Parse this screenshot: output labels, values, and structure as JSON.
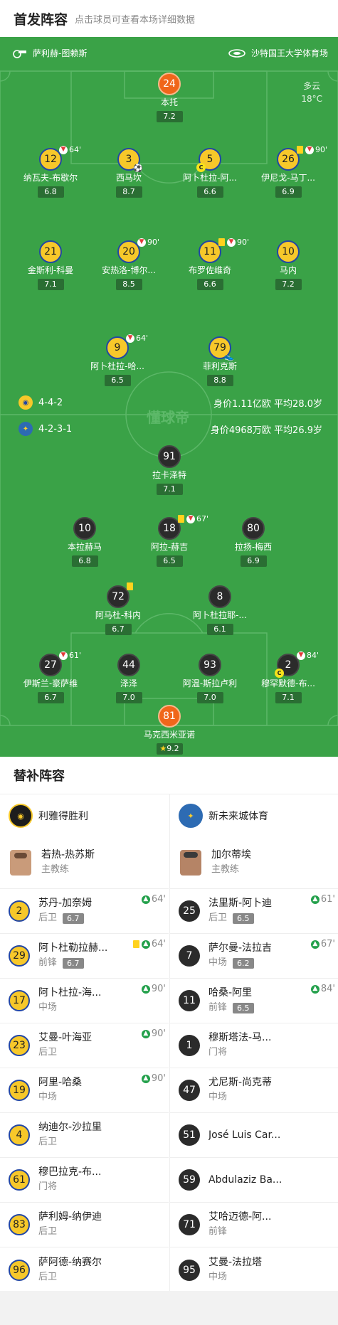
{
  "header": {
    "title": "首发阵容",
    "subtitle": "点击球员可查看本场详细数据"
  },
  "pitch": {
    "referee": "萨利赫-图赖斯",
    "venue": "沙特国王大学体育场",
    "weather": {
      "condition": "多云",
      "temp": "18°C"
    },
    "watermark": "懂球帝",
    "home_formation": "4-4-2",
    "home_value": "身价1.11亿欧  平均28.0岁",
    "away_formation": "4-2-3-1",
    "away_value": "身价4968万欧  平均26.9岁"
  },
  "home_players": [
    {
      "num": "24",
      "name": "本托",
      "rating": "7.2"
    },
    {
      "num": "12",
      "name": "纳瓦夫-布歇尔",
      "rating": "6.8",
      "sub": "64'"
    },
    {
      "num": "3",
      "name": "西马坎",
      "rating": "8.7"
    },
    {
      "num": "5",
      "name": "阿卜杜拉-阿...",
      "rating": "6.6",
      "cap": "C"
    },
    {
      "num": "26",
      "name": "伊尼戈-马丁...",
      "rating": "6.9",
      "sub": "90'"
    },
    {
      "num": "21",
      "name": "金斯利-科曼",
      "rating": "7.1"
    },
    {
      "num": "20",
      "name": "安热洛-博尔...",
      "rating": "8.5",
      "sub": "90'"
    },
    {
      "num": "11",
      "name": "布罗佐维奇",
      "rating": "6.6",
      "sub": "90'"
    },
    {
      "num": "10",
      "name": "马内",
      "rating": "7.2"
    },
    {
      "num": "9",
      "name": "阿卜杜拉-哈...",
      "rating": "6.5",
      "sub": "64'"
    },
    {
      "num": "79",
      "name": "菲利克斯",
      "rating": "8.8"
    }
  ],
  "away_players": [
    {
      "num": "91",
      "name": "拉卡泽特",
      "rating": "7.1"
    },
    {
      "num": "10",
      "name": "本拉赫马",
      "rating": "6.8"
    },
    {
      "num": "18",
      "name": "阿拉-赫吉",
      "rating": "6.5",
      "sub": "67'"
    },
    {
      "num": "80",
      "name": "拉扬-梅西",
      "rating": "6.9"
    },
    {
      "num": "72",
      "name": "阿马杜-科内",
      "rating": "6.7"
    },
    {
      "num": "8",
      "name": "阿卜杜拉耶-...",
      "rating": "6.1"
    },
    {
      "num": "27",
      "name": "伊斯兰-豪萨维",
      "rating": "6.7",
      "sub": "61'"
    },
    {
      "num": "44",
      "name": "泽泽",
      "rating": "7.0"
    },
    {
      "num": "93",
      "name": "阿温-斯拉卢利",
      "rating": "7.0"
    },
    {
      "num": "2",
      "name": "穆罕默德-布...",
      "rating": "7.1",
      "sub": "84'",
      "cap": "C"
    },
    {
      "num": "81",
      "name": "马克西米亚诺",
      "rating": "9.2"
    }
  ],
  "subs": {
    "title": "替补阵容",
    "home": {
      "team": "利雅得胜利",
      "coach": {
        "name": "若热-热苏斯",
        "role": "主教练"
      },
      "players": [
        {
          "num": "2",
          "name": "苏丹-加奈姆",
          "pos": "后卫",
          "rating": "6.7",
          "time": "64'"
        },
        {
          "num": "29",
          "name": "阿卜杜勒拉赫...",
          "pos": "前锋",
          "rating": "6.7",
          "time": "64'"
        },
        {
          "num": "17",
          "name": "阿卜杜拉-海...",
          "pos": "中场",
          "time": "90'"
        },
        {
          "num": "23",
          "name": "艾曼-叶海亚",
          "pos": "后卫",
          "time": "90'"
        },
        {
          "num": "19",
          "name": "阿里-哈桑",
          "pos": "中场",
          "time": "90'"
        },
        {
          "num": "4",
          "name": "纳迪尔-沙拉里",
          "pos": "后卫"
        },
        {
          "num": "61",
          "name": "穆巴拉克-布...",
          "pos": "门将"
        },
        {
          "num": "83",
          "name": "萨利姆-纳伊迪",
          "pos": "后卫"
        },
        {
          "num": "96",
          "name": "萨阿德-纳赛尔",
          "pos": "后卫"
        }
      ]
    },
    "away": {
      "team": "新未来城体育",
      "coach": {
        "name": "加尔蒂埃",
        "role": "主教练"
      },
      "players": [
        {
          "num": "25",
          "name": "法里斯-阿卜迪",
          "pos": "后卫",
          "rating": "6.5",
          "time": "61'"
        },
        {
          "num": "7",
          "name": "萨尔曼-法拉吉",
          "pos": "中场",
          "rating": "6.2",
          "time": "67'"
        },
        {
          "num": "11",
          "name": "哈桑-阿里",
          "pos": "前锋",
          "rating": "6.5",
          "time": "84'"
        },
        {
          "num": "1",
          "name": "穆斯塔法-马...",
          "pos": "门将"
        },
        {
          "num": "47",
          "name": "尤尼斯-尚克蒂",
          "pos": "中场"
        },
        {
          "num": "51",
          "name": "José Luis Car...",
          "pos": ""
        },
        {
          "num": "59",
          "name": "Abdulaziz Ba...",
          "pos": ""
        },
        {
          "num": "71",
          "name": "艾哈迈德-阿...",
          "pos": "前锋"
        },
        {
          "num": "95",
          "name": "艾曼-法拉塔",
          "pos": "中场"
        }
      ]
    }
  },
  "colors": {
    "pitch": "#3aa247",
    "home": "#f7c82a",
    "away": "#2b2b2b",
    "keeper": "#f0661a"
  }
}
